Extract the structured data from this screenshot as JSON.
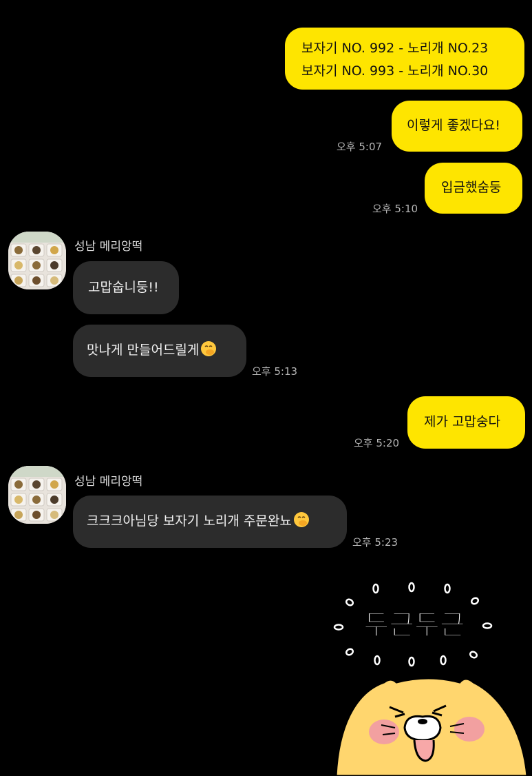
{
  "chat": {
    "contact_name": "성남 메리앙떡",
    "messages": [
      {
        "lines": [
          "보자기 NO. 992 - 노리개 NO.23",
          "보자기 NO. 993 - 노리개 NO.30"
        ]
      },
      {
        "text": "이렇게 좋겠다요!",
        "time": "오후 5:07"
      },
      {
        "text": "입금했숨둥",
        "time": "오후 5:10"
      },
      {
        "text": "고맙숩니둥!!"
      },
      {
        "text": "맛나게 만들어드릴게",
        "emoji": "face-with-hand-over-mouth",
        "time": "오후 5:13"
      },
      {
        "text": "제가 고맙숭다",
        "time": "오후 5:20"
      },
      {
        "text": "크크크아님당 보자기 노리개 주문완뇨",
        "emoji": "face-with-hand-over-mouth",
        "time": "오후 5:23"
      }
    ],
    "sticker": {
      "text": "두근두근",
      "character": "hamster-sticker"
    }
  },
  "colors": {
    "my_bubble": "#FEE500",
    "their_bubble": "#2c2c2c",
    "background": "#000000",
    "sticker_body": "#FFD66E",
    "cheek": "#F2A0A0"
  }
}
